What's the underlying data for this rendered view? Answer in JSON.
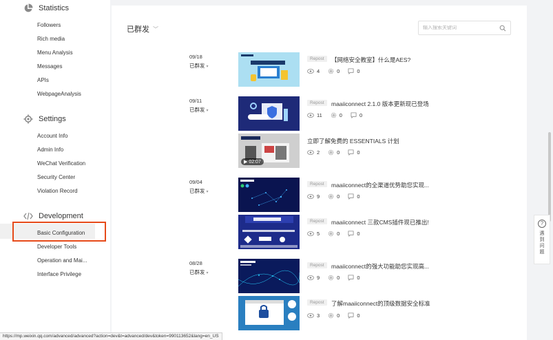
{
  "sidebar": {
    "groups": [
      {
        "title": "Statistics",
        "icon": "pie-chart-icon",
        "items": [
          "Followers",
          "Rich media",
          "Menu Analysis",
          "Messages",
          "APIs",
          "WebpageAnalysis"
        ]
      },
      {
        "title": "Settings",
        "icon": "gear-icon",
        "items": [
          "Account Info",
          "Admin Info",
          "WeChat Verification",
          "Security Center",
          "Violation Record"
        ]
      },
      {
        "title": "Development",
        "icon": "code-icon",
        "items": [
          "Basic Configuration",
          "Developer Tools",
          "Operation and Mai...",
          "Interface Privilege"
        ]
      }
    ]
  },
  "main": {
    "title": "已群发",
    "search_placeholder": "输入搜索关键词",
    "badge_label": "Repost",
    "status_label": "已群发",
    "articles": [
      {
        "date": "09/18",
        "title": "【网络安全教室】什么是AES?",
        "repost": true,
        "views": "4",
        "likes": "0",
        "comments": "0"
      },
      {
        "date": "09/11",
        "title": "maaiiconnect 2.1.0 版本更新现已登场",
        "repost": true,
        "views": "11",
        "likes": "0",
        "comments": "0"
      },
      {
        "date": "",
        "title": "立即了解免费的 ESSENTIALS 计划",
        "repost": false,
        "views": "2",
        "likes": "0",
        "comments": "0",
        "duration": "02:07"
      },
      {
        "date": "09/04",
        "title": "maaiiconnect的全渠道优势助您实现...",
        "repost": true,
        "views": "9",
        "likes": "0",
        "comments": "0"
      },
      {
        "date": "",
        "title": "maaiiconnect 三款CMS插件现已推出!",
        "repost": true,
        "views": "5",
        "likes": "0",
        "comments": "0"
      },
      {
        "date": "08/28",
        "title": "maaiiconnect的强大功能助您实现高...",
        "repost": true,
        "views": "9",
        "likes": "0",
        "comments": "0"
      },
      {
        "date": "",
        "title": "了解maaiiconnect的顶级数据安全标准",
        "repost": true,
        "views": "3",
        "likes": "0",
        "comments": "0"
      }
    ]
  },
  "help": {
    "label": "遇到问题"
  },
  "statusbar": {
    "url": "https://mp.weixin.qq.com/advanced/advanced?action=dev&t=advanced/dev&token=990113652&lang=en_US"
  },
  "colors": {
    "highlight": "#e64a19",
    "page_bg": "#f2f3f5"
  }
}
